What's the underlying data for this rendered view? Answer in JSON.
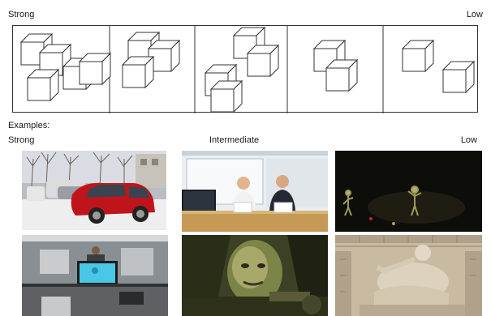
{
  "scale_top": {
    "left_label": "Strong",
    "right_label": "Low"
  },
  "examples": {
    "heading": "Examples:",
    "left_label": "Strong",
    "middle_label": "Intermediate",
    "right_label": "Low"
  },
  "cube_panels": [
    {
      "name": "cube-panel-1",
      "cubes": 5
    },
    {
      "name": "cube-panel-2",
      "cubes": 3
    },
    {
      "name": "cube-panel-3",
      "cubes": 4
    },
    {
      "name": "cube-panel-4",
      "cubes": 2
    },
    {
      "name": "cube-panel-5",
      "cubes": 2
    }
  ],
  "example_images": [
    {
      "name": "example-image-parked-cars",
      "icon": "parked-cars-photo"
    },
    {
      "name": "example-image-two-presenters",
      "icon": "presenters-photo"
    },
    {
      "name": "example-image-dark-scene-figures",
      "icon": "dark-scene-photo"
    },
    {
      "name": "example-image-office-monitor",
      "icon": "office-photo"
    },
    {
      "name": "example-image-game-character",
      "icon": "game-character-photo"
    },
    {
      "name": "example-image-statue",
      "icon": "statue-photo"
    }
  ]
}
